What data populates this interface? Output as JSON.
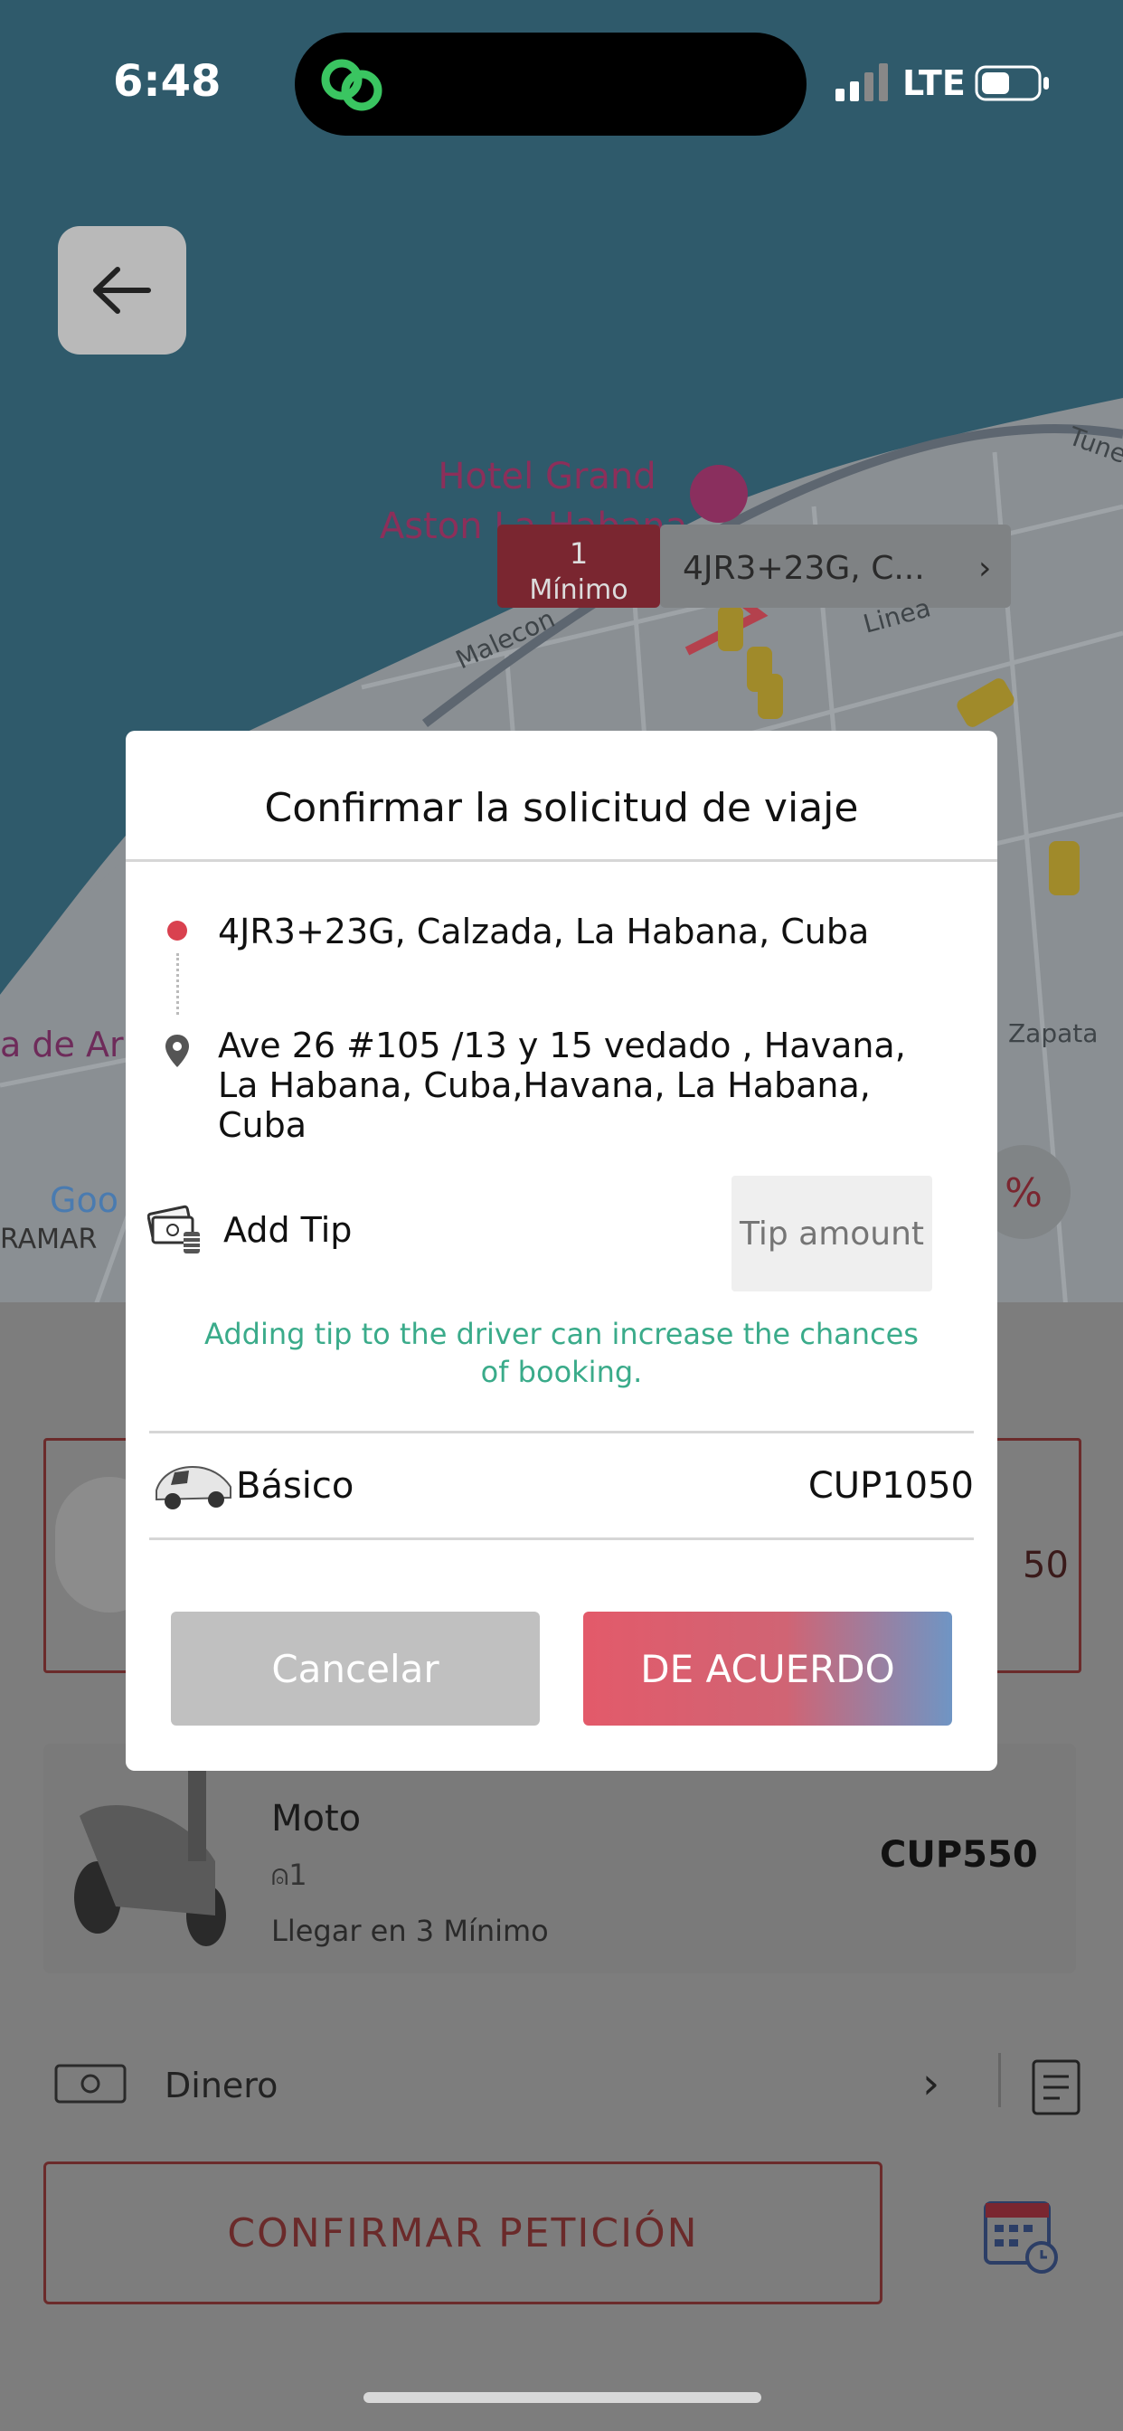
{
  "status_bar": {
    "time": "6:48",
    "network": "LTE"
  },
  "map": {
    "poi_name_line1": "Hotel Grand",
    "poi_name_line2": "Aston La Habana",
    "pin_badge_number": "1",
    "pin_badge_unit": "Mínimo",
    "pin_address": "4JR3+23G, C...",
    "street_malecon": "Malecon",
    "street_linea": "Linea",
    "street_tunel": "Tune",
    "street_zapata": "Zapata",
    "area_label": "a de Ar",
    "area_label2": "RAMAR",
    "google_logo": "Goo"
  },
  "vehicles": {
    "basic_price_partial": "50",
    "moto": {
      "name": "Moto",
      "seats": "1",
      "eta": "Llegar en 3 Mínimo",
      "price": "CUP550"
    }
  },
  "payment": {
    "method": "Dinero"
  },
  "confirm_button": "CONFIRMAR PETICIÓN",
  "dialog": {
    "title": "Confirmar la solicitud de viaje",
    "pickup": "4JR3+23G, Calzada, La Habana, Cuba",
    "dropoff_line1": "Ave 26 #105 /13 y 15 vedado , Havana,",
    "dropoff_line2": "La Habana, Cuba,Havana,  La Habana,",
    "dropoff_line3": "Cuba",
    "tip_label": "Add Tip",
    "tip_placeholder": "Tip amount",
    "tip_hint_line1": "Adding tip to the driver can increase the chances",
    "tip_hint_line2": "of booking.",
    "vehicle_name": "Básico",
    "vehicle_price": "CUP1050",
    "cancel_label": "Cancelar",
    "ok_label": "DE ACUERDO"
  },
  "colors": {
    "accent_red": "#d9414f",
    "hint_green": "#3aab8a",
    "ok_gradient_end": "#6f95c4"
  }
}
